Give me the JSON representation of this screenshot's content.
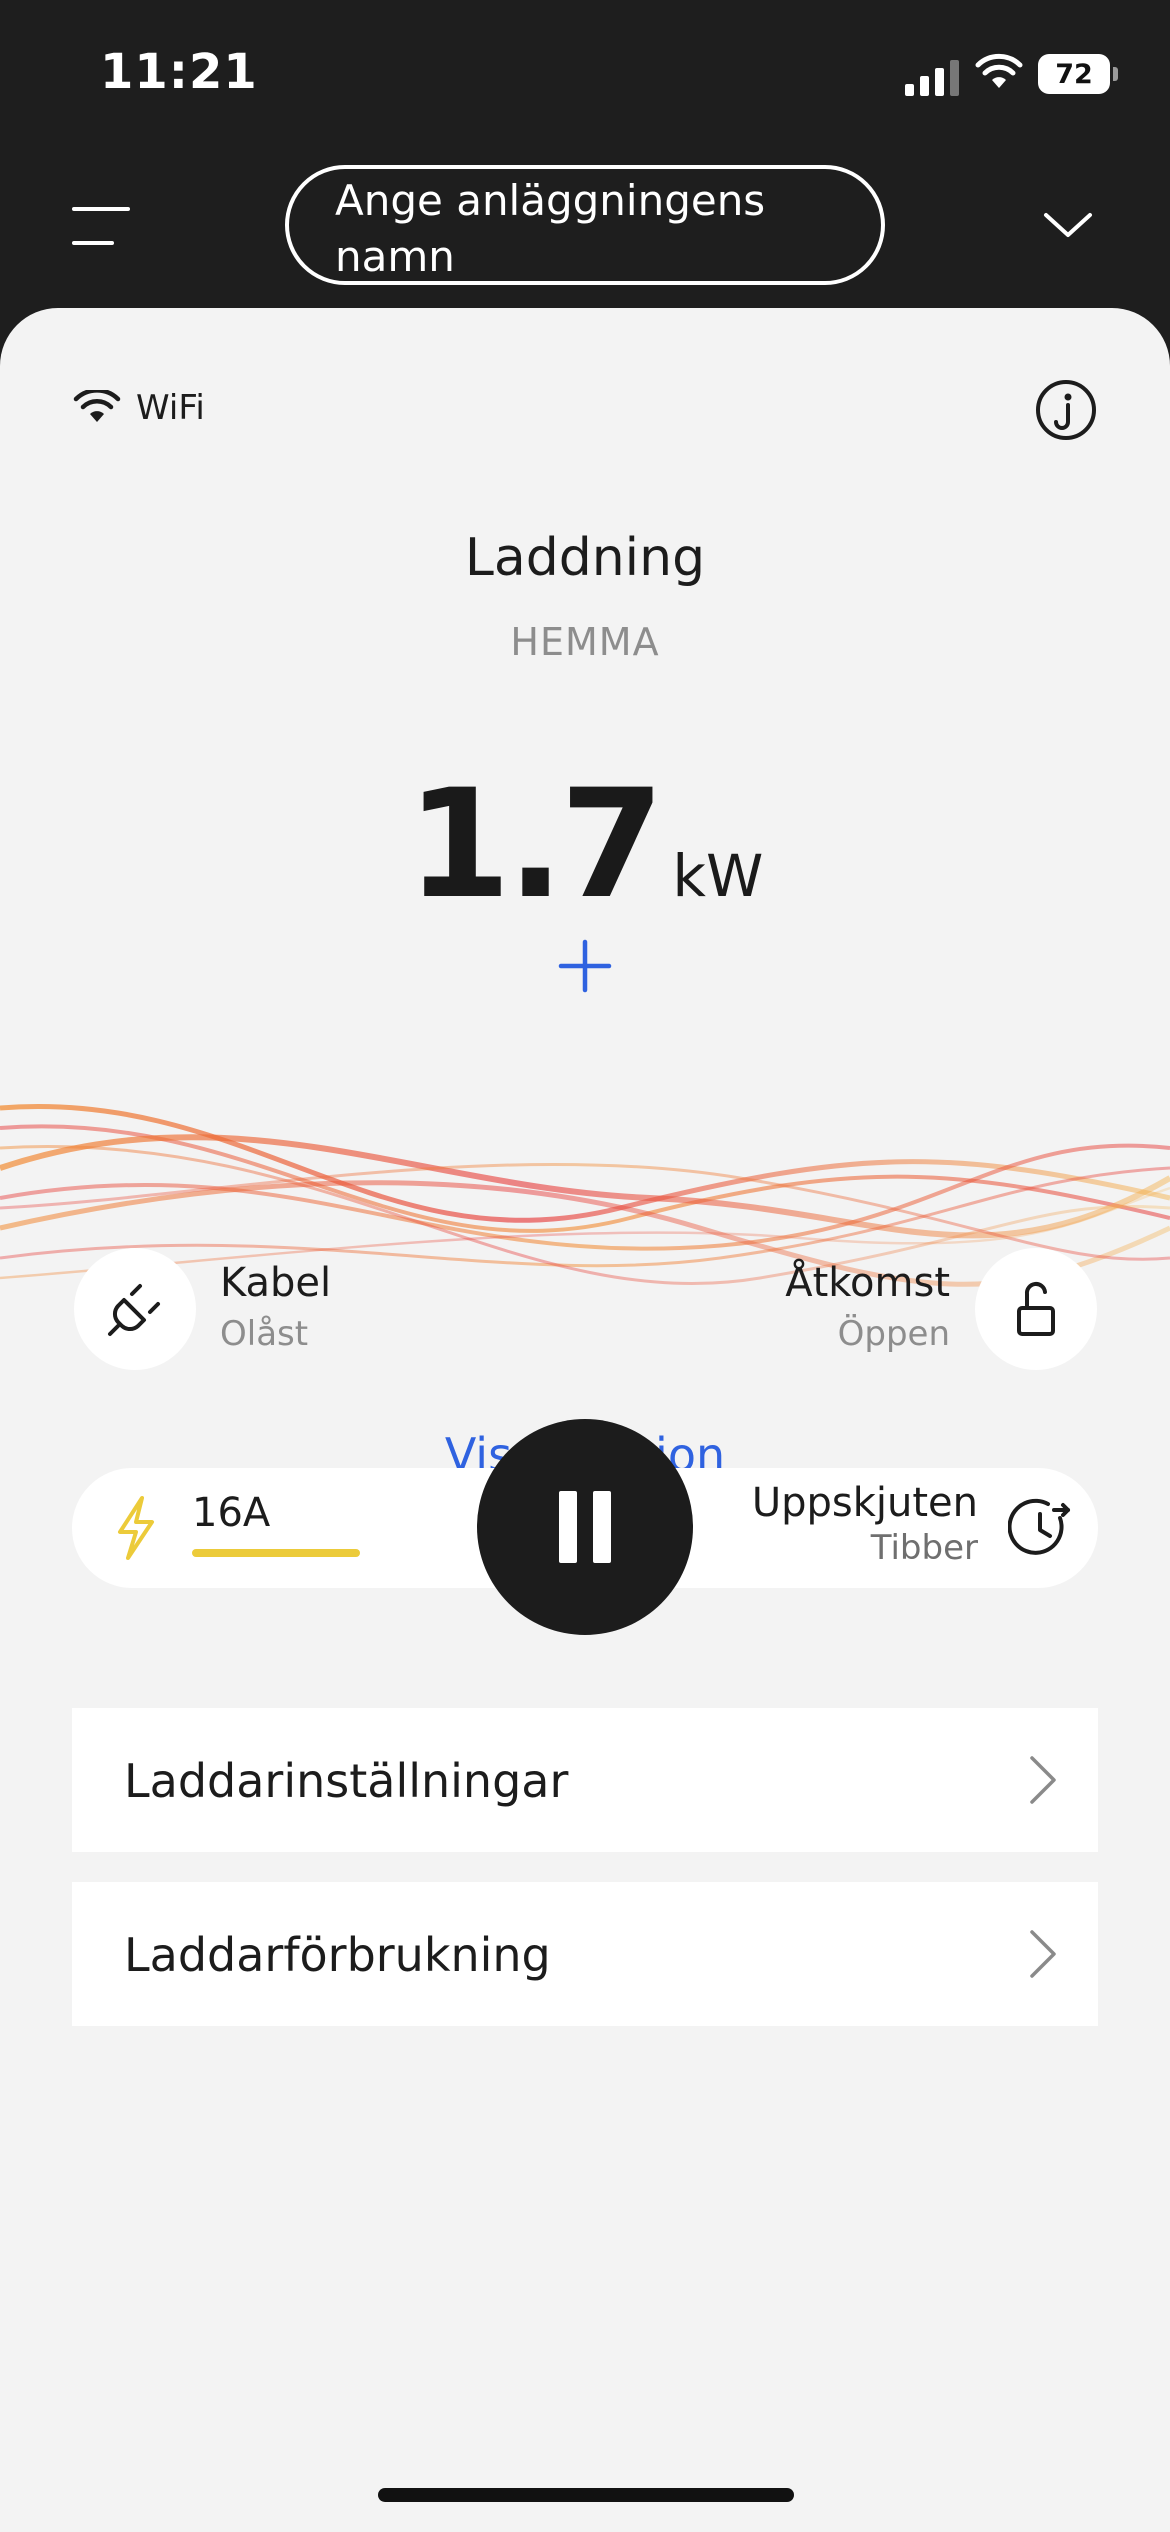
{
  "status_bar": {
    "time": "11:21",
    "battery": "72"
  },
  "header": {
    "site_name": "Ange anläggningens namn"
  },
  "connection": {
    "label": "WiFi"
  },
  "charger": {
    "status": "Laddning",
    "location": "HEMMA",
    "power_value": "1.7",
    "power_unit": "kW"
  },
  "session_link": "Visa session",
  "cable": {
    "label": "Kabel",
    "state": "Olåst"
  },
  "access": {
    "label": "Åtkomst",
    "state": "Öppen"
  },
  "current": {
    "value": "16A"
  },
  "schedule": {
    "label": "Uppskjuten",
    "provider": "Tibber"
  },
  "menu": [
    {
      "label": "Laddarinställningar"
    },
    {
      "label": "Laddarförbrukning"
    }
  ],
  "colors": {
    "accent": "#2f62e0",
    "bolt": "#eccb3a",
    "header_bg": "#1e1e1e",
    "card_bg": "#f3f3f3",
    "wave_red": "#e6393a",
    "wave_orange": "#f28a2e"
  }
}
